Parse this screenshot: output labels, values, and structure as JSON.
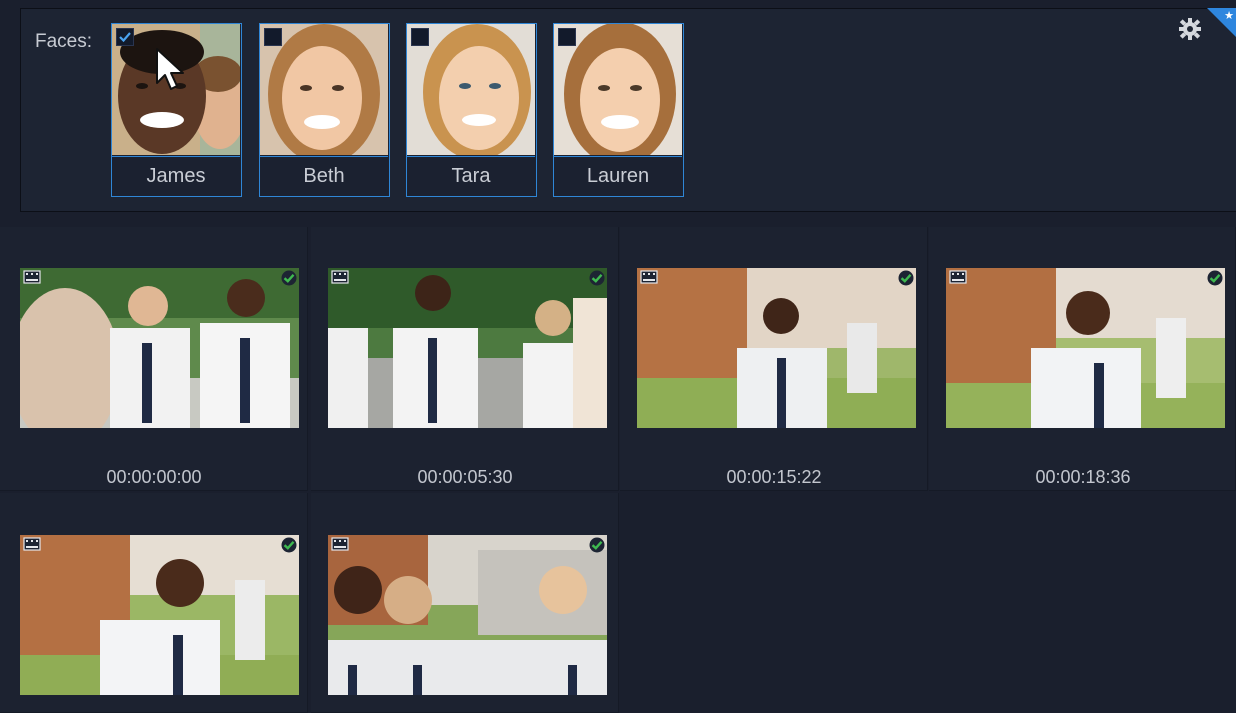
{
  "faces_panel": {
    "label": "Faces:",
    "settings_icon": "gear-icon",
    "faces": [
      {
        "name": "James",
        "checked": true
      },
      {
        "name": "Beth",
        "checked": false
      },
      {
        "name": "Tara",
        "checked": false
      },
      {
        "name": "Lauren",
        "checked": false
      }
    ]
  },
  "clips": [
    {
      "time": "00:00:00:00",
      "verified": true
    },
    {
      "time": "00:00:05:30",
      "verified": true
    },
    {
      "time": "00:00:15:22",
      "verified": true
    },
    {
      "time": "00:00:18:36",
      "verified": true
    },
    {
      "verified": true
    },
    {
      "verified": true
    }
  ],
  "colors": {
    "background": "#1a1f2d",
    "accent": "#2f86d6",
    "check_green": "#3fb950"
  }
}
